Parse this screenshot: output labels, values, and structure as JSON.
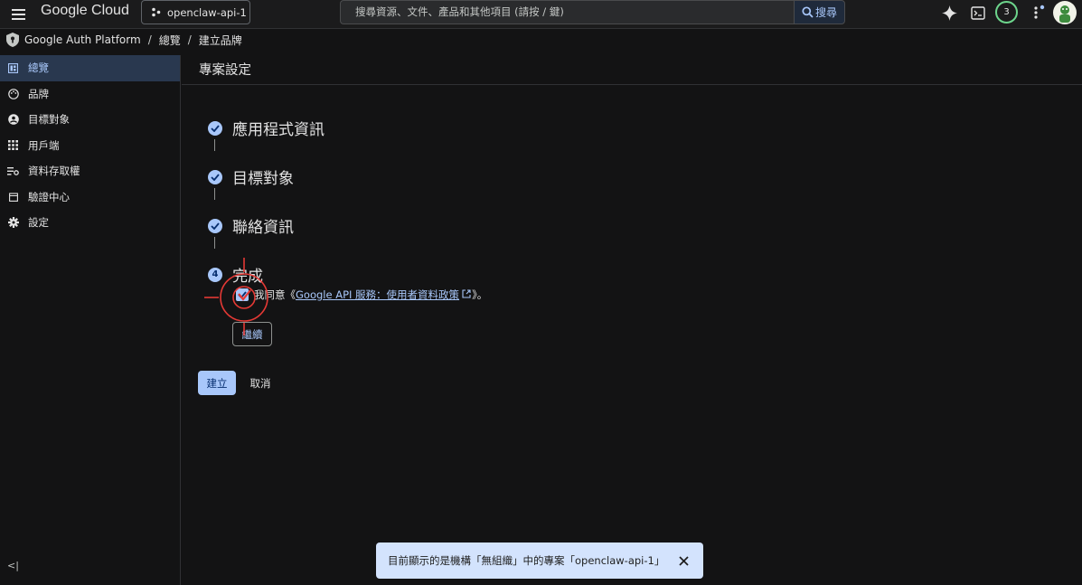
{
  "topbar": {
    "logo": "Google Cloud",
    "project": "openclaw-api-1",
    "search_placeholder": "搜尋資源、文件、產品和其他項目 (請按 / 鍵)",
    "search_button": "搜尋",
    "notification_count": "3"
  },
  "breadcrumb": {
    "product": "Google Auth Platform",
    "overview": "總覽",
    "current": "建立品牌"
  },
  "sidebar": {
    "items": [
      {
        "label": "總覽",
        "icon": "dashboard-icon"
      },
      {
        "label": "品牌",
        "icon": "palette-icon"
      },
      {
        "label": "目標對象",
        "icon": "person-icon"
      },
      {
        "label": "用戶端",
        "icon": "apps-grid-icon"
      },
      {
        "label": "資料存取權",
        "icon": "data-access-icon"
      },
      {
        "label": "驗證中心",
        "icon": "calendar-icon"
      },
      {
        "label": "設定",
        "icon": "gear-icon"
      }
    ],
    "collapse_label": "<|"
  },
  "main": {
    "title": "專案設定",
    "steps": [
      {
        "label": "應用程式資訊",
        "state": "done"
      },
      {
        "label": "目標對象",
        "state": "done"
      },
      {
        "label": "聯絡資訊",
        "state": "done"
      },
      {
        "label": "完成",
        "state": "current",
        "number": "4"
      }
    ],
    "agree_prefix": "我同意《",
    "policy_link": "Google API 服務：使用者資料政策",
    "agree_suffix": "》。",
    "continue_label": "繼續",
    "create_label": "建立",
    "cancel_label": "取消"
  },
  "snackbar": {
    "message": "目前顯示的是機構「無組織」中的專案「openclaw-api-1」"
  },
  "colors": {
    "accent": "#a8c7fa",
    "background": "#131314",
    "annotation": "#e53935"
  }
}
